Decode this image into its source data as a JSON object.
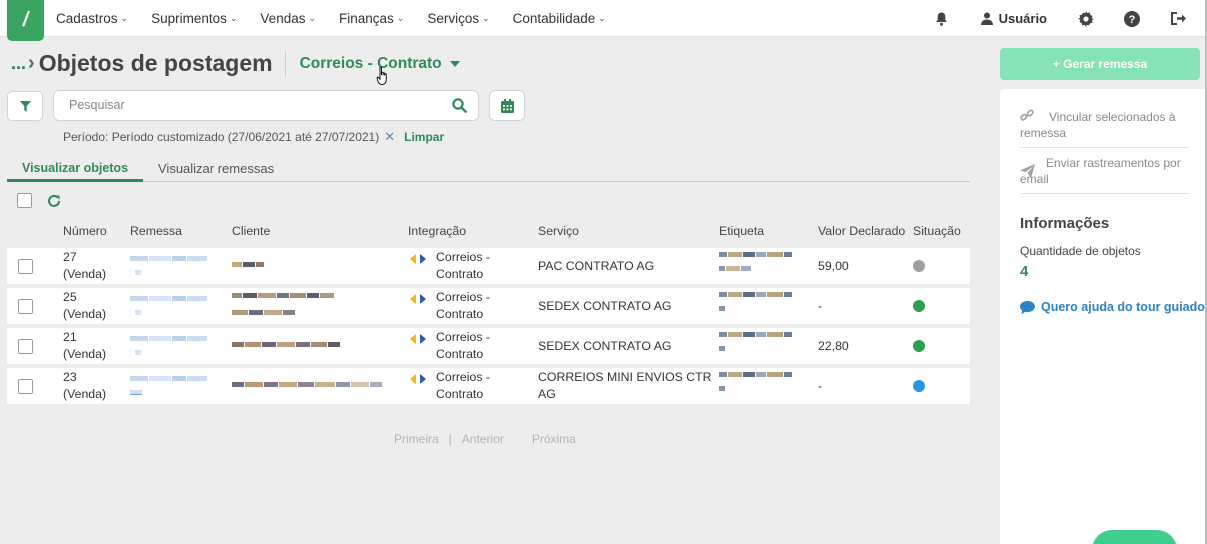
{
  "nav": {
    "logo_text": "/",
    "items": [
      {
        "label": "Cadastros"
      },
      {
        "label": "Suprimentos"
      },
      {
        "label": "Vendas"
      },
      {
        "label": "Finanças"
      },
      {
        "label": "Serviços"
      },
      {
        "label": "Contabilidade"
      }
    ],
    "user_label": "Usuário"
  },
  "header": {
    "breadcrumb_dots": "...",
    "title": "Objetos de postagem",
    "integration_dropdown": "Correios - Contrato"
  },
  "actions": {
    "generate_label": "+ Gerar remessa"
  },
  "search": {
    "placeholder": "Pesquisar",
    "period_text": "Período: Período customizado (27/06/2021 até 27/07/2021)",
    "clear_label": "Limpar"
  },
  "tabs": [
    {
      "label": "Visualizar objetos",
      "active": true
    },
    {
      "label": "Visualizar remessas",
      "active": false
    }
  ],
  "table": {
    "columns": [
      "Número",
      "Remessa",
      "Cliente",
      "Integração",
      "Serviço",
      "Etiqueta",
      "Valor Declarado",
      "Situação"
    ],
    "rows": [
      {
        "numero": "27",
        "tipo": "(Venda)",
        "integracao_1": "Correios -",
        "integracao_2": "Contrato",
        "servico_1": "PAC CONTRATO AG",
        "servico_2": "",
        "valor": "59,00",
        "status_color": "#a39e9e"
      },
      {
        "numero": "25",
        "tipo": "(Venda)",
        "integracao_1": "Correios -",
        "integracao_2": "Contrato",
        "servico_1": "SEDEX CONTRATO AG",
        "servico_2": "",
        "valor": "-",
        "status_color": "#2e9e4f"
      },
      {
        "numero": "21",
        "tipo": "(Venda)",
        "integracao_1": "Correios -",
        "integracao_2": "Contrato",
        "servico_1": "SEDEX CONTRATO AG",
        "servico_2": "",
        "valor": "22,80",
        "status_color": "#2e9e4f"
      },
      {
        "numero": "23",
        "tipo": "(Venda)",
        "integracao_1": "Correios -",
        "integracao_2": "Contrato",
        "servico_1": "CORREIOS MINI ENVIOS CTR",
        "servico_2": "AG",
        "valor": "-",
        "status_color": "#2896df"
      }
    ]
  },
  "pager": {
    "first": "Primeira",
    "prev": "Anterior",
    "next": "Próxima"
  },
  "panel": {
    "link_label": "Vincular selecionados à remessa",
    "email_label": "Enviar rastreamentos por email",
    "info_title": "Informações",
    "qty_label": "Quantidade de objetos",
    "qty_value": "4",
    "tour_label": "Quero ajuda do tour guiado"
  },
  "colors": {
    "accent": "#2e8b57",
    "logo": "#3aa35f",
    "generate_button": "#86e3b8",
    "link_blue": "#2a83c6"
  }
}
